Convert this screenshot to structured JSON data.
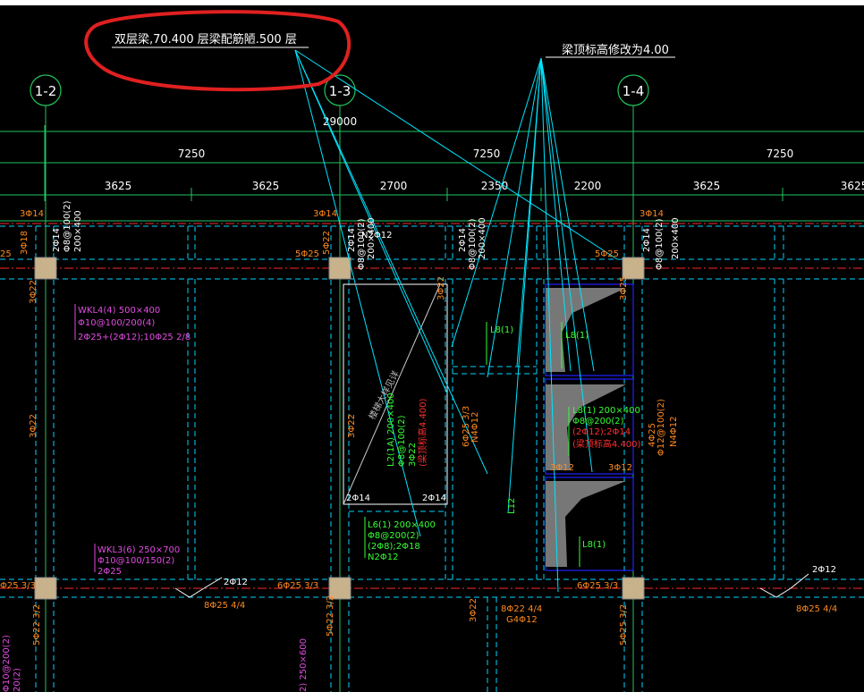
{
  "annotations": {
    "left_note": "双层梁,70.400   层梁配筋陋.500   层",
    "right_note": "梁顶标高修改为4.00"
  },
  "grid_axes": [
    "1-2",
    "1-3",
    "1-4"
  ],
  "dims": {
    "total": "29000",
    "spans": [
      "7250",
      "7250",
      "7250"
    ],
    "subs": [
      "3625",
      "3625",
      "2700",
      "2350",
      "2200",
      "3625",
      "3625"
    ]
  },
  "labels_orange": {
    "a": "3Φ14",
    "b": "3Φ14",
    "c": "3Φ14",
    "d": "3Φ18",
    "e": "5Φ25",
    "f": "5Φ22",
    "g": "5Φ25",
    "h": "3Φ25",
    "i": "3Φ22",
    "j": "3Φ22",
    "k": "3Φ22",
    "l": "3Φ22",
    "m": "3Φ12",
    "n": "3Φ12",
    "o": "4Φ25",
    "p": "Φ12@100(2)",
    "q": "N4Φ12",
    "r": "6Φ25 3/3",
    "s": "N4Φ12",
    "t": "2Φ12",
    "u": "8Φ25 4/4",
    "v": "6Φ25 3/3",
    "w": "8Φ22 4/4",
    "x": "G4Φ12",
    "y": "6Φ25 3/3",
    "z": "5Φ22 3/2",
    "aa": "5Φ22 3/2",
    "ab": "5Φ25 3/2",
    "ac": "3Φ22",
    "ad": "2Φ12",
    "ae": "8Φ25 4/4",
    "af": "Φ25 3/3",
    "ag": "25"
  },
  "labels_white": {
    "a": "2Φ14",
    "b": "Φ8@100(2)",
    "c": "200×400",
    "d": "2Φ14",
    "e": "Φ8@100(2)",
    "f": "200×400",
    "g": "N2Φ12",
    "h": "2Φ14",
    "i": "Φ8@100(2)",
    "j": "200×400",
    "k": "2Φ14",
    "l": "Φ8@100(2)",
    "m": "200×400",
    "n": "2Φ14",
    "o": "2Φ14",
    "p": "楼梯大样见详"
  },
  "labels_magenta": {
    "a": "WKL4(4) 500×400",
    "b": "Φ10@100/200(4)",
    "c": "2Φ25+(2Φ12);10Φ25 2/8",
    "d": "WKL3(6) 250×700",
    "e": "Φ10@100/150(2)",
    "f": "2Φ25",
    "g": "Φ10@200(2)",
    "h": "2) 250×600",
    "i": "20(2)"
  },
  "labels_green": {
    "l9_a": "L8(1)",
    "l9_b": "L8(1)",
    "l9_c": "L8(1)",
    "l8": [
      "L8(1) 200×400",
      "Φ8@200(2)",
      "(2Φ12);2Φ14"
    ],
    "l8_red": "(梁顶标高4.400)",
    "l2": [
      "L2(1A) 200×400",
      "Φ8@100(2)",
      "3Φ22"
    ],
    "l2_red": "(梁顶标高4.400)",
    "l6": [
      "L6(1) 200×400",
      "Φ8@200(2)",
      "(2Φ8);2Φ18",
      "N2Φ12"
    ],
    "l12": "L12"
  },
  "colors": {
    "background": "#000000",
    "annotation_red": "#e02020",
    "leader_cyan": "#00e5ff",
    "axis_green": "#22c55e",
    "beam_red": "#ff2a2a",
    "column_fill": "#c8b28c",
    "label_orange": "#ff8a1e",
    "label_magenta": "#e24ce2",
    "label_green": "#35ff35",
    "hatch_grey": "#777777",
    "blue": "#2020ff"
  }
}
